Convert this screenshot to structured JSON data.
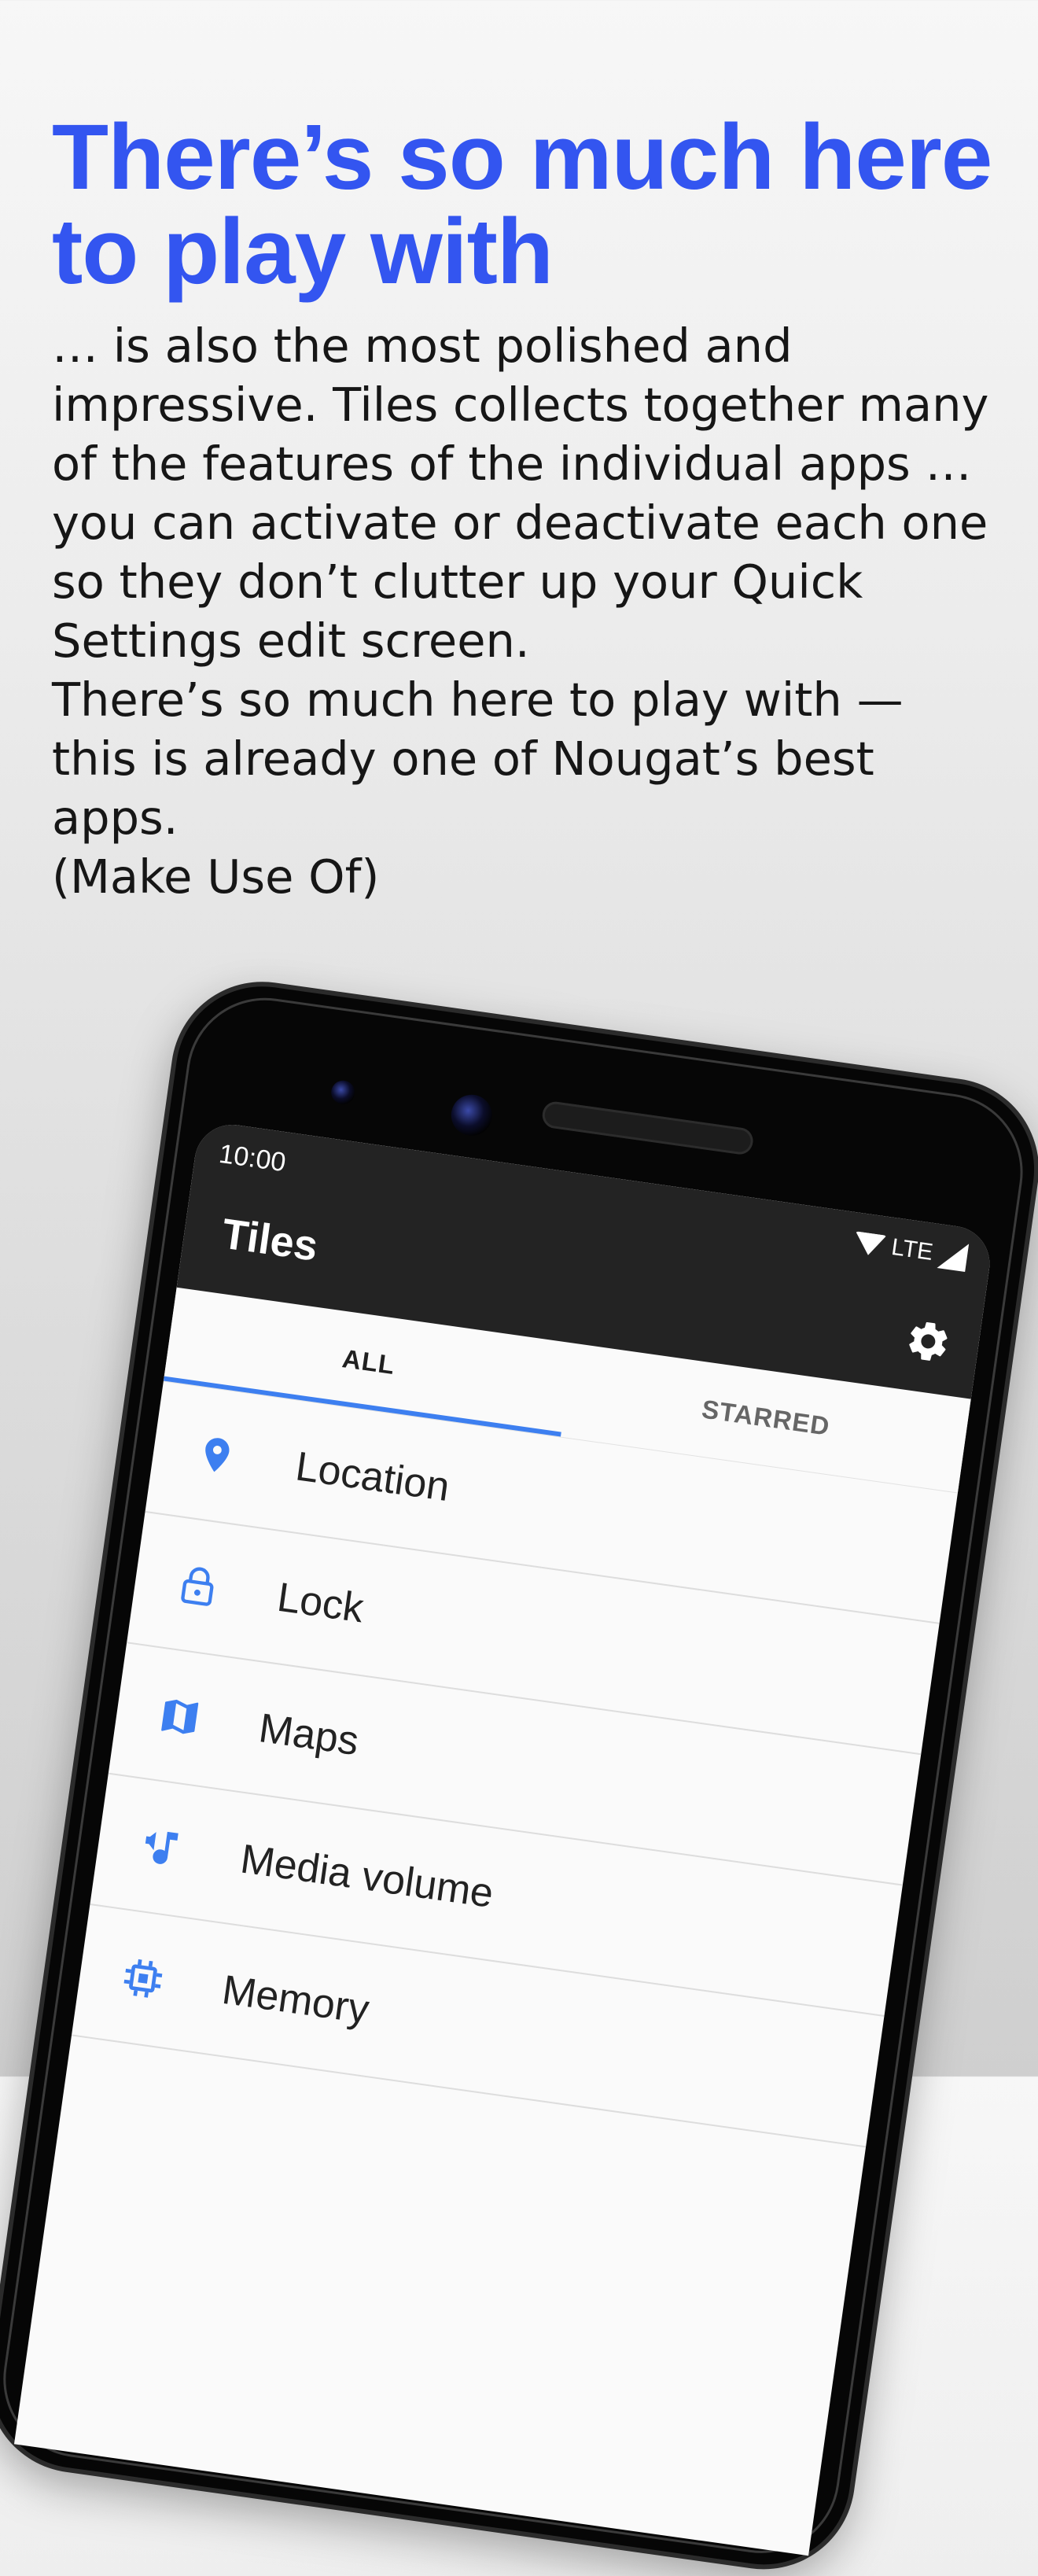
{
  "promo": {
    "headline": "There’s so much here to play with",
    "quote_p1": "… is also the most polished and impressive. Tiles collects together many of the features of the individual apps … you can activate or deactivate each one so they don’t clutter up your Quick Settings edit screen.",
    "quote_p2": "There’s so much here to play with — this is already one of Nougat’s best apps.",
    "quote_source": "(Make Use Of)"
  },
  "phone": {
    "status": {
      "time": "10:00",
      "network": "LTE"
    },
    "app_title": "Tiles",
    "tabs": [
      {
        "label": "ALL",
        "active": true
      },
      {
        "label": "STARRED",
        "active": false
      }
    ],
    "list": [
      {
        "label": "Location",
        "icon": "location-pin-icon"
      },
      {
        "label": "Lock",
        "icon": "lock-icon"
      },
      {
        "label": "Maps",
        "icon": "map-icon"
      },
      {
        "label": "Media volume",
        "icon": "media-volume-icon"
      },
      {
        "label": "Memory",
        "icon": "memory-chip-icon"
      }
    ]
  },
  "colors": {
    "headline": "#3355f0",
    "accent": "#3d7ff0",
    "appbar": "#232323"
  }
}
